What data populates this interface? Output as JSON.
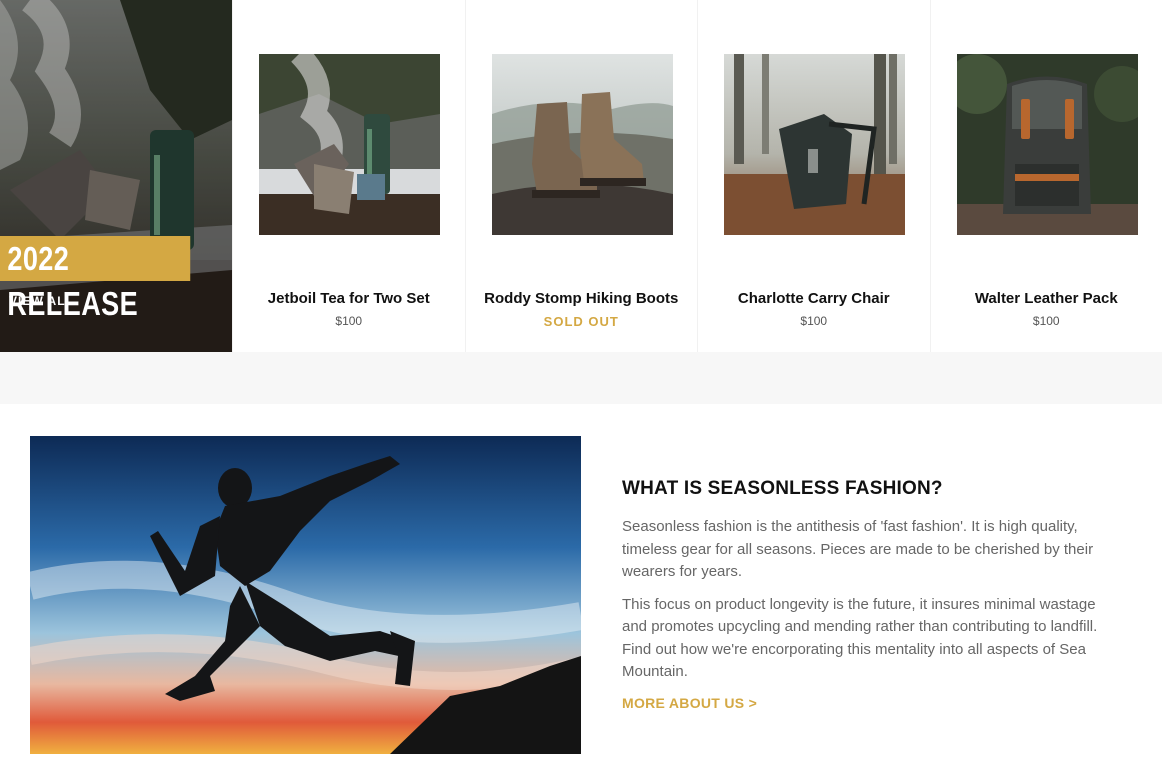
{
  "featured_collection": {
    "title": "2022 RELEASE",
    "link_label": "VIEW ALL",
    "accent_color": "#d4a843"
  },
  "products": [
    {
      "name": "Jetboil Tea for Two Set",
      "price": "$100",
      "sold_out": false
    },
    {
      "name": "Roddy Stomp Hiking Boots",
      "price": "SOLD OUT",
      "sold_out": true
    },
    {
      "name": "Charlotte Carry Chair",
      "price": "$100",
      "sold_out": false
    },
    {
      "name": "Walter Leather Pack",
      "price": "$100",
      "sold_out": false
    }
  ],
  "about": {
    "heading": "WHAT IS SEASONLESS FASHION?",
    "paragraph_1": "Seasonless fashion is the antithesis of 'fast fashion'. It is high quality, timeless gear for all seasons. Pieces are made to be cherished by their wearers for years.",
    "paragraph_2": "This focus on product longevity is the future, it insures minimal wastage and promotes upcycling and mending rather than contributing to landfill. Find out how we're encorporating this mentality into all aspects of Sea Mountain.",
    "link_label": "MORE ABOUT US >"
  }
}
